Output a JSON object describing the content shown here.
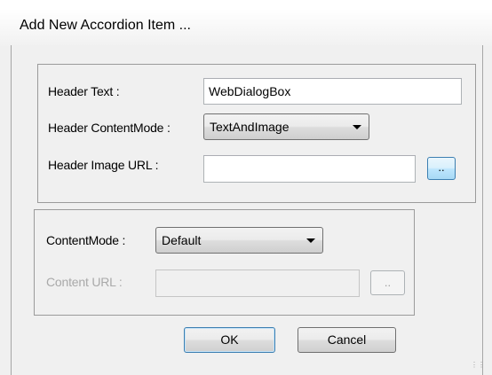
{
  "window": {
    "title": "Add New Accordion Item ..."
  },
  "header_group": {
    "header_text_label": "Header Text :",
    "header_text_value": "WebDialogBox",
    "content_mode_label": "Header ContentMode :",
    "content_mode_value": "TextAndImage",
    "image_url_label": "Header Image URL :",
    "image_url_value": "",
    "browse_label": ".."
  },
  "content_group": {
    "content_mode_label": "ContentMode :",
    "content_mode_value": "Default",
    "content_url_label": "Content URL :",
    "content_url_value": "",
    "browse_label": ".."
  },
  "buttons": {
    "ok": "OK",
    "cancel": "Cancel"
  }
}
